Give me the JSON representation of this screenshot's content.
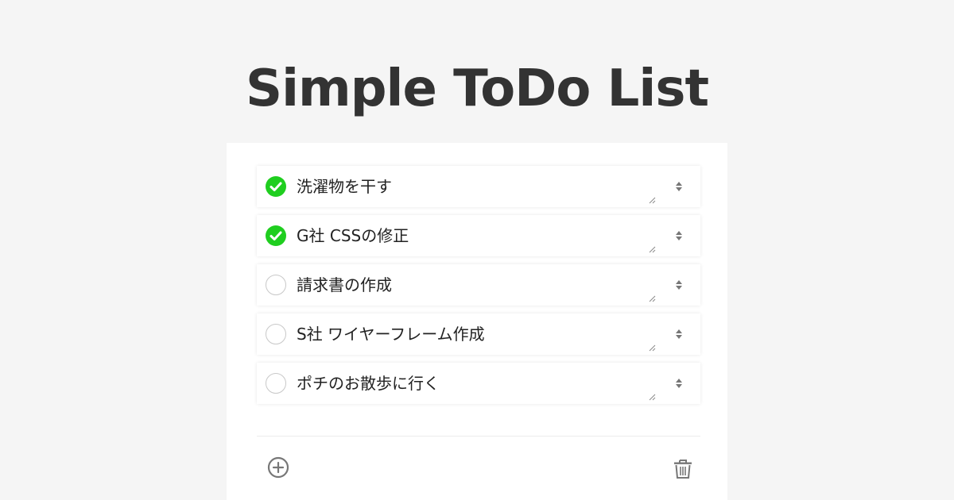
{
  "page": {
    "title": "Simple ToDo List"
  },
  "colors": {
    "background": "#f5f5f5",
    "card": "#ffffff",
    "done": "#1fce1f",
    "text": "#333333",
    "icon": "#777777"
  },
  "todos": [
    {
      "label": "洗濯物を干す",
      "done": true
    },
    {
      "label": "G社 CSSの修正",
      "done": true
    },
    {
      "label": "請求書の作成",
      "done": false
    },
    {
      "label": "S社 ワイヤーフレーム作成",
      "done": false
    },
    {
      "label": "ポチのお散歩に行く",
      "done": false
    }
  ],
  "footer": {
    "add_icon": "plus-circle-icon",
    "delete_icon": "trash-icon"
  }
}
